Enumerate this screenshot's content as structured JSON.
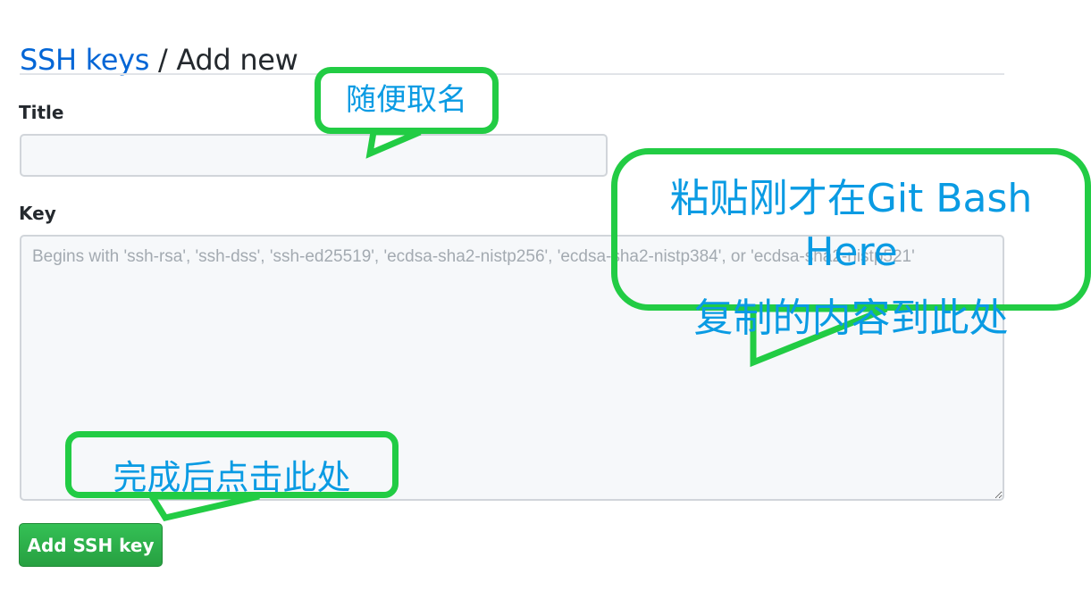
{
  "header": {
    "link_label": "SSH keys",
    "separator": "/",
    "current_label": "Add new"
  },
  "form": {
    "title_label": "Title",
    "title_value": "",
    "key_label": "Key",
    "key_placeholder": "Begins with 'ssh-rsa', 'ssh-dss', 'ssh-ed25519', 'ecdsa-sha2-nistp256', 'ecdsa-sha2-nistp384', or 'ecdsa-sha2-nistp521'",
    "submit_label": "Add SSH key"
  },
  "annotations": {
    "title_note": "随便取名",
    "key_note_line1": "粘贴刚才在Git Bash Here",
    "key_note_line2": "复制的内容到此处",
    "submit_note": "完成后点击此处",
    "callout_border_color": "#22cc44",
    "callout_text_color": "#0a9be3"
  },
  "colors": {
    "link": "#0366d6",
    "button": "#28a745"
  }
}
